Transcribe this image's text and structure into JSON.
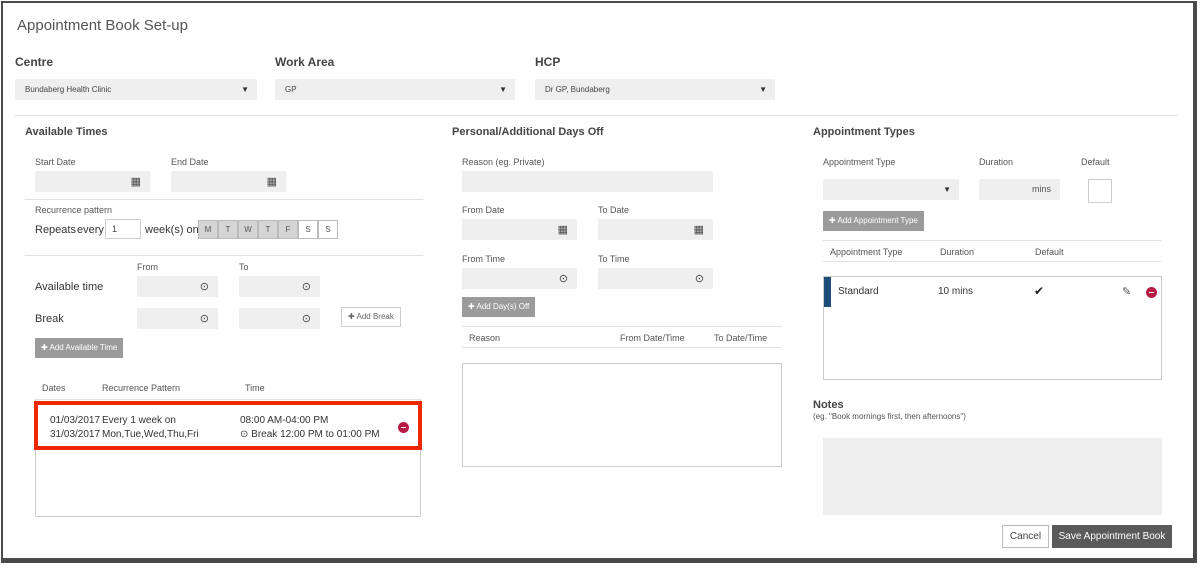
{
  "page_title": "Appointment Book Set-up",
  "filters": {
    "centre": {
      "label": "Centre",
      "value": "Bundaberg Health Clinic"
    },
    "work_area": {
      "label": "Work Area",
      "value": "GP"
    },
    "hcp": {
      "label": "HCP",
      "value": "Dr GP, Bundaberg"
    }
  },
  "available_times": {
    "heading": "Available Times",
    "start_date_label": "Start Date",
    "end_date_label": "End Date",
    "recurrence_label": "Recurrence pattern",
    "repeats_label": "Repeats",
    "every_label": "every",
    "every_value": "1",
    "weeks_on_label": "week(s) on",
    "days": [
      {
        "label": "M",
        "selected": true
      },
      {
        "label": "T",
        "selected": true
      },
      {
        "label": "W",
        "selected": true
      },
      {
        "label": "T",
        "selected": true
      },
      {
        "label": "F",
        "selected": true
      },
      {
        "label": "S",
        "selected": false
      },
      {
        "label": "S",
        "selected": false
      }
    ],
    "from_label": "From",
    "to_label": "To",
    "available_time_label": "Available time",
    "break_label": "Break",
    "add_break_label": "Add Break",
    "add_available_time_label": "Add Available Time",
    "table": {
      "headers": [
        "Dates",
        "Recurrence Pattern",
        "Time"
      ],
      "rows": [
        {
          "date_start": "01/03/2017",
          "date_end": "31/03/2017",
          "recurrence_line1": "Every 1 week on",
          "recurrence_line2": "Mon,Tue,Wed,Thu,Fri",
          "time": "08:00 AM-04:00 PM",
          "break": "Break 12:00 PM to 01:00 PM"
        }
      ]
    }
  },
  "days_off": {
    "heading": "Personal/Additional Days Off",
    "reason_label": "Reason (eg. Private)",
    "from_date_label": "From Date",
    "to_date_label": "To Date",
    "from_time_label": "From Time",
    "to_time_label": "To Time",
    "add_days_off_label": "Add Day(s) Off",
    "table_headers": [
      "Reason",
      "From Date/Time",
      "To Date/Time"
    ]
  },
  "appointment_types": {
    "heading": "Appointment Types",
    "type_label": "Appointment Type",
    "duration_label": "Duration",
    "default_label": "Default",
    "mins_label": "mins",
    "add_type_label": "Add Appointment Type",
    "table_headers": [
      "Appointment Type",
      "Duration",
      "Default"
    ],
    "rows": [
      {
        "type": "Standard",
        "duration": "10 mins",
        "default": "✔"
      }
    ]
  },
  "notes": {
    "heading": "Notes",
    "hint": "(eg. \"Book mornings first, then afternoons\")"
  },
  "actions": {
    "cancel_label": "Cancel",
    "save_label": "Save Appointment Book"
  },
  "colors": {
    "accent_bar": "#1e4d7a",
    "remove": "#b71c45",
    "highlight": "#f02800",
    "save_button": "#5a5a5a"
  }
}
